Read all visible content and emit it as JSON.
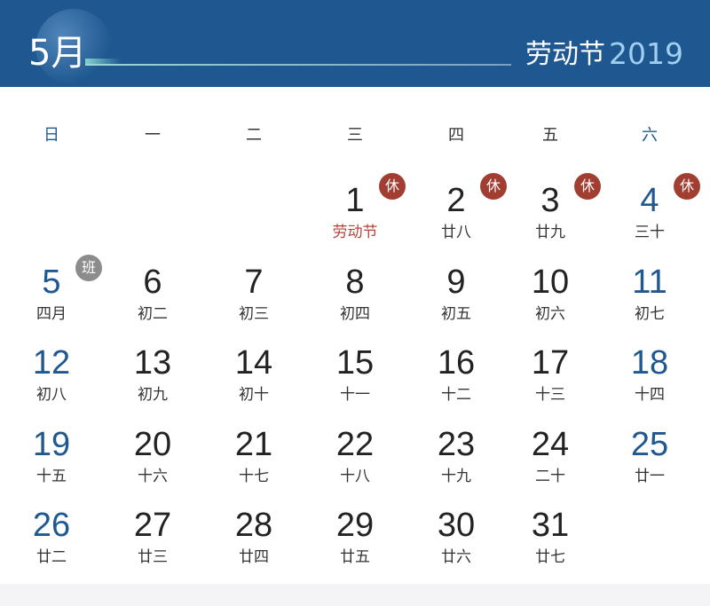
{
  "header": {
    "month": "5月",
    "holiday": "劳动节",
    "year": "2019"
  },
  "colors": {
    "header_bg": "#1f5890",
    "weekend_text": "#1f5890",
    "rest_badge": "#a23d32",
    "work_badge": "#8c8c8c",
    "festival_text": "#b5453c",
    "year_text": "#9fd0f0"
  },
  "weekdays": [
    "日",
    "一",
    "二",
    "三",
    "四",
    "五",
    "六"
  ],
  "weeks": [
    [
      null,
      null,
      null,
      {
        "day": "1",
        "lunar": "劳动节",
        "festival": true,
        "badge": "休",
        "badge_type": "rest"
      },
      {
        "day": "2",
        "lunar": "廿八",
        "badge": "休",
        "badge_type": "rest"
      },
      {
        "day": "3",
        "lunar": "廿九",
        "badge": "休",
        "badge_type": "rest"
      },
      {
        "day": "4",
        "lunar": "三十",
        "badge": "休",
        "badge_type": "rest"
      }
    ],
    [
      {
        "day": "5",
        "lunar": "四月",
        "badge": "班",
        "badge_type": "work"
      },
      {
        "day": "6",
        "lunar": "初二"
      },
      {
        "day": "7",
        "lunar": "初三"
      },
      {
        "day": "8",
        "lunar": "初四"
      },
      {
        "day": "9",
        "lunar": "初五"
      },
      {
        "day": "10",
        "lunar": "初六"
      },
      {
        "day": "11",
        "lunar": "初七"
      }
    ],
    [
      {
        "day": "12",
        "lunar": "初八"
      },
      {
        "day": "13",
        "lunar": "初九"
      },
      {
        "day": "14",
        "lunar": "初十"
      },
      {
        "day": "15",
        "lunar": "十一"
      },
      {
        "day": "16",
        "lunar": "十二"
      },
      {
        "day": "17",
        "lunar": "十三"
      },
      {
        "day": "18",
        "lunar": "十四"
      }
    ],
    [
      {
        "day": "19",
        "lunar": "十五"
      },
      {
        "day": "20",
        "lunar": "十六"
      },
      {
        "day": "21",
        "lunar": "十七"
      },
      {
        "day": "22",
        "lunar": "十八"
      },
      {
        "day": "23",
        "lunar": "十九"
      },
      {
        "day": "24",
        "lunar": "二十"
      },
      {
        "day": "25",
        "lunar": "廿一"
      }
    ],
    [
      {
        "day": "26",
        "lunar": "廿二"
      },
      {
        "day": "27",
        "lunar": "廿三"
      },
      {
        "day": "28",
        "lunar": "廿四"
      },
      {
        "day": "29",
        "lunar": "廿五"
      },
      {
        "day": "30",
        "lunar": "廿六"
      },
      {
        "day": "31",
        "lunar": "廿七"
      },
      null
    ]
  ]
}
